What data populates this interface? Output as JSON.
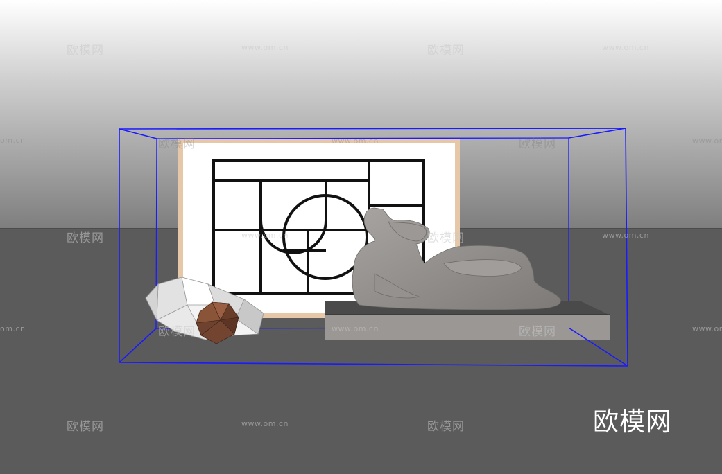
{
  "watermarks": {
    "brand": "欧模网",
    "url": "www.om.cn",
    "url_cut": "om.cn"
  },
  "logo_text": "欧模网",
  "colors": {
    "bounding_box": "#1a1aff",
    "frame": "#e6c8a8",
    "plinth": "#9a9794",
    "sculpture": "#8f8c89",
    "gem": "#7a4a33"
  }
}
